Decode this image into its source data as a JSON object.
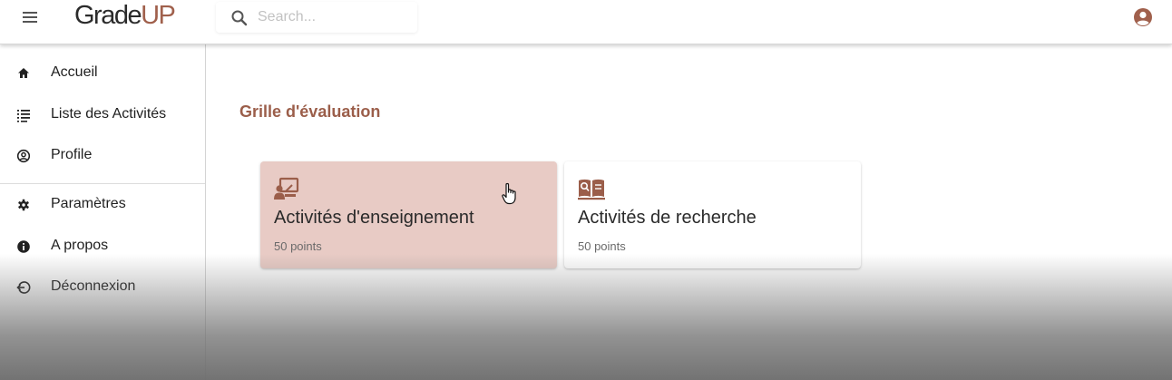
{
  "header": {
    "logo_main": "Grade",
    "logo_accent": "UP",
    "search_placeholder": "Search..."
  },
  "sidebar": {
    "items": [
      {
        "label": "Accueil",
        "icon": "home-icon"
      },
      {
        "label": "Liste des Activités",
        "icon": "list-icon"
      },
      {
        "label": "Profile",
        "icon": "profile-icon"
      },
      {
        "label": "Paramètres",
        "icon": "gear-icon"
      },
      {
        "label": "A propos",
        "icon": "info-icon"
      },
      {
        "label": "Déconnexion",
        "icon": "logout-icon"
      }
    ]
  },
  "main": {
    "title": "Grille d'évaluation",
    "cards": [
      {
        "title": "Activités d'enseignement",
        "subtitle": "50 points",
        "icon": "teaching-icon",
        "selected": true
      },
      {
        "title": "Activités de recherche",
        "subtitle": "50 points",
        "icon": "research-book-icon",
        "selected": false
      }
    ]
  },
  "colors": {
    "accent": "#9b5e4a",
    "card_selected_bg": "#e8cbc5"
  }
}
